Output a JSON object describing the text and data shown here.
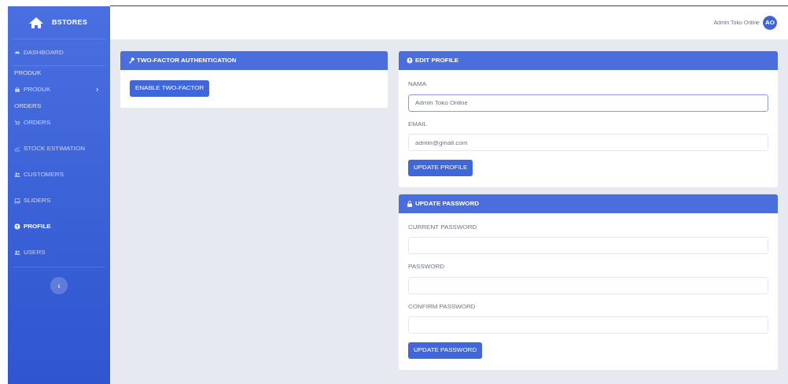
{
  "sidebar": {
    "brand": "BSTORES",
    "items": [
      {
        "kind": "link",
        "label": "DASHBOARD",
        "selected": false
      },
      {
        "kind": "heading",
        "label": "PRODUK"
      },
      {
        "kind": "link",
        "label": "PRODUK",
        "selected": false,
        "submenu": true
      },
      {
        "kind": "heading",
        "label": "ORDERS"
      },
      {
        "kind": "link",
        "label": "ORDERS",
        "selected": false
      },
      {
        "kind": "link",
        "label": "STOCK ESTIMATION",
        "selected": false
      },
      {
        "kind": "link",
        "label": "CUSTOMERS",
        "selected": false
      },
      {
        "kind": "link",
        "label": "SLIDERS",
        "selected": false
      },
      {
        "kind": "link",
        "label": "PROFILE",
        "selected": true
      },
      {
        "kind": "link",
        "label": "USERS",
        "selected": false
      }
    ],
    "collapse_button": "‹"
  },
  "topbar": {
    "user_name": "Admin Toko Online",
    "avatar": "AO"
  },
  "two_factor": {
    "title": "TWO-FACTOR AUTHENTICATION",
    "button": "ENABLE TWO-FACTOR"
  },
  "edit_profile": {
    "title": "EDIT PROFILE",
    "fields": [
      {
        "label": "NAMA",
        "value": "Admin Toko Online",
        "focused": true
      },
      {
        "label": "EMAIL",
        "value": "admin@gmail.com",
        "focused": false
      }
    ],
    "button": "UPDATE PROFILE"
  },
  "update_password": {
    "title": "UPDATE PASSWORD",
    "fields": [
      {
        "label": "CURRENT PASSWORD",
        "focused": false
      },
      {
        "label": "PASSWORD",
        "focused": false
      },
      {
        "label": "CONFIRM PASSWORD",
        "focused": false
      }
    ],
    "button": "UPDATE PASSWORD"
  }
}
